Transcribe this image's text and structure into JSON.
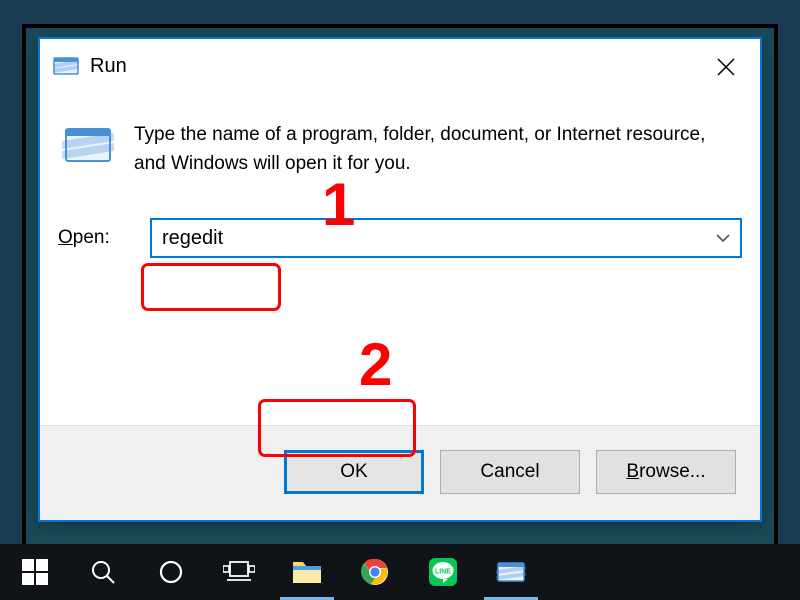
{
  "dialog": {
    "title": "Run",
    "description": "Type the name of a program, folder, document, or Internet resource, and Windows will open it for you.",
    "open_label_prefix": "O",
    "open_label_rest": "pen:",
    "input_value": "regedit",
    "buttons": {
      "ok": "OK",
      "cancel": "Cancel",
      "browse_prefix": "B",
      "browse_rest": "rowse..."
    }
  },
  "annotations": {
    "step1": "1",
    "step2": "2"
  },
  "taskbar": {
    "items": [
      {
        "name": "start-button"
      },
      {
        "name": "search-button"
      },
      {
        "name": "cortana-button"
      },
      {
        "name": "taskview-button"
      },
      {
        "name": "file-explorer-button"
      },
      {
        "name": "chrome-button"
      },
      {
        "name": "line-button"
      },
      {
        "name": "run-app-button"
      }
    ]
  }
}
